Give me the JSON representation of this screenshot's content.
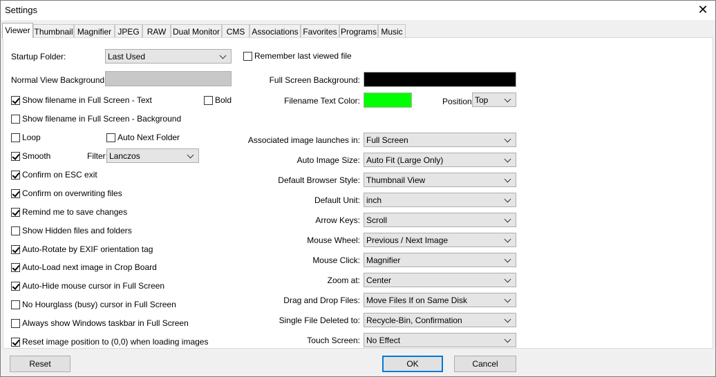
{
  "window": {
    "title": "Settings",
    "close_glyph": "✕"
  },
  "tabs": [
    "Viewer",
    "Thumbnail",
    "Magnifier",
    "JPEG",
    "RAW",
    "Dual Monitor",
    "CMS",
    "Associations",
    "Favorites",
    "Programs",
    "Music"
  ],
  "left": {
    "startup_folder_label": "Startup Folder:",
    "startup_folder_value": "Last Used",
    "normal_bg_label": "Normal View Background:",
    "normal_bg_color": "#c8c8c8",
    "show_filename_text": "Show filename in Full Screen - Text",
    "bold": "Bold",
    "show_filename_bg": "Show filename in Full Screen - Background",
    "loop": "Loop",
    "auto_next_folder": "Auto Next Folder",
    "smooth": "Smooth",
    "filter_label": "Filter:",
    "filter_value": "Lanczos",
    "confirm_esc": "Confirm on ESC exit",
    "confirm_overwrite": "Confirm on overwriting files",
    "remind_save": "Remind me to save changes",
    "show_hidden": "Show Hidden files and folders",
    "auto_rotate": "Auto-Rotate by EXIF orientation tag",
    "auto_load": "Auto-Load next image in Crop Board",
    "auto_hide": "Auto-Hide mouse cursor in Full Screen",
    "no_hourglass": "No Hourglass (busy) cursor in Full Screen",
    "always_taskbar": "Always show Windows taskbar in Full Screen",
    "reset_position": "Reset image position to (0,0) when loading images"
  },
  "right": {
    "remember_last": "Remember last viewed file",
    "full_screen_bg_label": "Full Screen Background:",
    "full_screen_bg_color": "#000000",
    "filename_color_label": "Filename Text Color:",
    "filename_color": "#00ff00",
    "position_label": "Position:",
    "position_value": "Top",
    "associated_label": "Associated image launches in:",
    "associated_value": "Full Screen",
    "auto_size_label": "Auto Image Size:",
    "auto_size_value": "Auto Fit (Large Only)",
    "browser_style_label": "Default Browser Style:",
    "browser_style_value": "Thumbnail View",
    "default_unit_label": "Default Unit:",
    "default_unit_value": "inch",
    "arrow_keys_label": "Arrow Keys:",
    "arrow_keys_value": "Scroll",
    "mouse_wheel_label": "Mouse Wheel:",
    "mouse_wheel_value": "Previous / Next Image",
    "mouse_click_label": "Mouse Click:",
    "mouse_click_value": "Magnifier",
    "zoom_at_label": "Zoom at:",
    "zoom_at_value": "Center",
    "drag_drop_label": "Drag and Drop Files:",
    "drag_drop_value": "Move Files If on Same Disk",
    "single_deleted_label": "Single File Deleted to:",
    "single_deleted_value": "Recycle-Bin, Confirmation",
    "touch_screen_label": "Touch Screen:",
    "touch_screen_value": "No Effect"
  },
  "buttons": {
    "reset": "Reset",
    "ok": "OK",
    "cancel": "Cancel"
  }
}
